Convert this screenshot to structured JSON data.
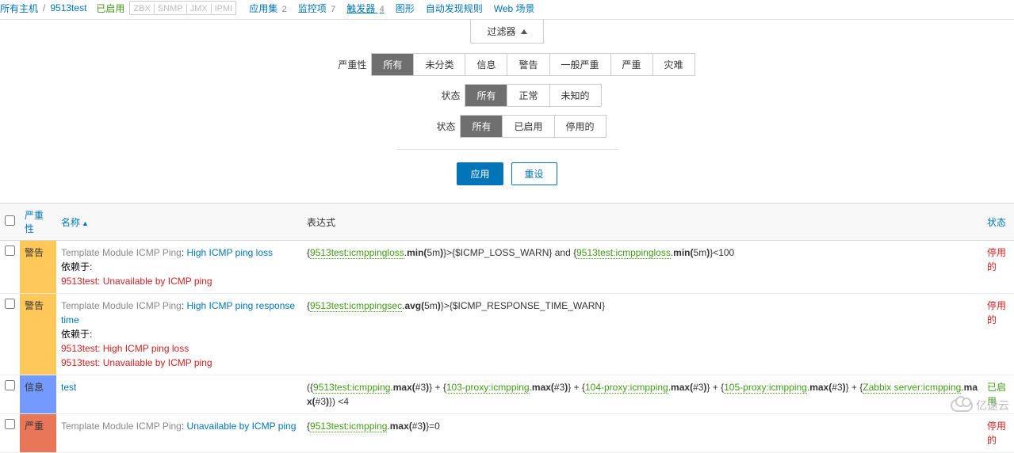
{
  "breadcrumb": {
    "allhosts": "所有主机",
    "host": "9513test",
    "enabled": "已启用",
    "protocols": [
      "ZBX",
      "SNMP",
      "JMX",
      "IPMI"
    ],
    "tabs": {
      "apps": {
        "label": "应用集",
        "count": "2"
      },
      "items": {
        "label": "监控项",
        "count": "7"
      },
      "triggers": {
        "label": "触发器",
        "count": "4"
      },
      "graphs": {
        "label": "图形"
      },
      "discover": {
        "label": "自动发现规则"
      },
      "web": {
        "label": "Web 场景"
      }
    }
  },
  "filter": {
    "tab_label": "过滤器",
    "severity_label": "严重性",
    "severity_opts": [
      "所有",
      "未分类",
      "信息",
      "警告",
      "一般严重",
      "严重",
      "灾难"
    ],
    "state_label": "状态",
    "state_opts": [
      "所有",
      "正常",
      "未知的"
    ],
    "status_label": "状态",
    "status_opts": [
      "所有",
      "已启用",
      "停用的"
    ],
    "apply": "应用",
    "reset": "重设"
  },
  "table": {
    "head": {
      "severity": "严重性",
      "name": "名称",
      "expression": "表达式",
      "status": "状态"
    }
  },
  "rows": [
    {
      "sev_class": "sev-warn",
      "sev_text": "警告",
      "tmpl": "Template Module ICMP Ping",
      "name": "High ICMP ping loss",
      "dep_label": "依赖于:",
      "deps": [
        "9513test: Unavailable by ICMP ping"
      ],
      "expr_html": "{<a>9513test:icmppingloss</a>.<b>min(</b>5m<b>)</b>}>{$ICMP_LOSS_WARN} and {<a>9513test:icmppingloss</a>.<b>min(</b>5m<b>)</b>}<100",
      "status_text": "停用的",
      "status_class": "status-dis"
    },
    {
      "sev_class": "sev-warn",
      "sev_text": "警告",
      "tmpl": "Template Module ICMP Ping",
      "name": "High ICMP ping response time",
      "dep_label": "依赖于:",
      "deps": [
        "9513test: High ICMP ping loss",
        "9513test: Unavailable by ICMP ping"
      ],
      "expr_html": "{<a>9513test:icmppingsec</a>.<b>avg(</b>5m<b>)</b>}>{$ICMP_RESPONSE_TIME_WARN}",
      "status_text": "停用的",
      "status_class": "status-dis"
    },
    {
      "sev_class": "sev-info",
      "sev_text": "信息",
      "tmpl": "",
      "name": "test",
      "dep_label": "",
      "deps": [],
      "expr_html": "({<a>9513test:icmpping</a>.<b>max(</b>#3<b>)</b>} + {<a>103-proxy:icmpping</a>.<b>max(</b>#3<b>)</b>} + {<a>104-proxy:icmpping</a>.<b>max(</b>#3<b>)</b>} + {<a>105-proxy:icmpping</a>.<b>max(</b>#3<b>)</b>} + {<a>Zabbix server:icmpping</a>.<b>max(</b>#3<b>)</b>}) <4",
      "status_text": "已启用",
      "status_class": "status-en"
    },
    {
      "sev_class": "sev-high",
      "sev_text": "严重",
      "tmpl": "Template Module ICMP Ping",
      "name": "Unavailable by ICMP ping",
      "dep_label": "",
      "deps": [],
      "expr_html": "{<a>9513test:icmpping</a>.<b>max(</b>#3<b>)</b>}=0",
      "status_text": "停用的",
      "status_class": "status-dis"
    }
  ],
  "watermark": "亿速云"
}
